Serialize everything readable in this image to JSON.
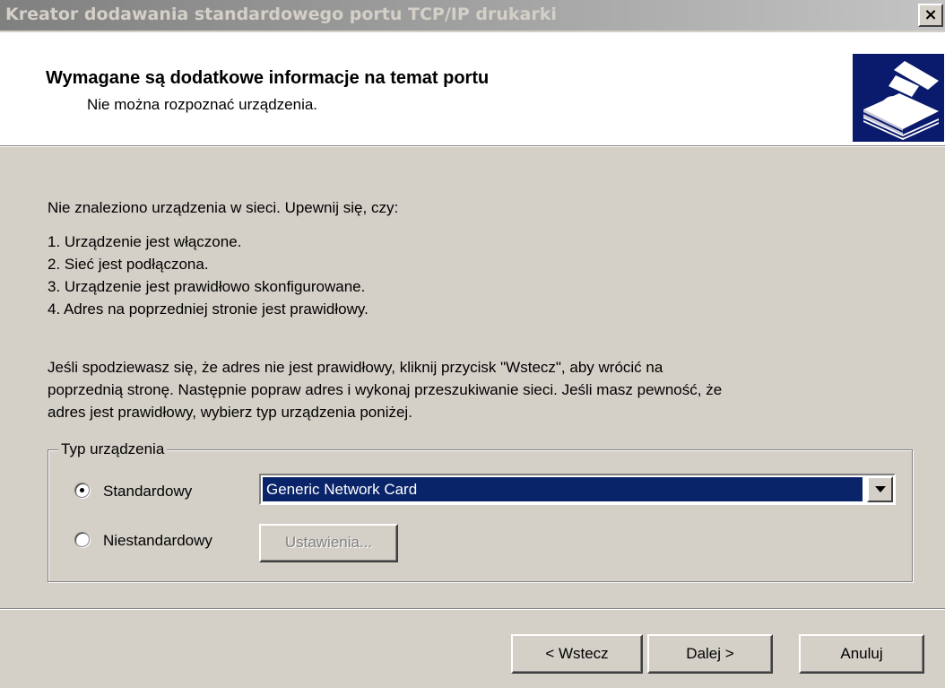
{
  "window": {
    "title": "Kreator dodawania standardowego portu TCP/IP drukarki",
    "close_label": "×"
  },
  "header": {
    "title": "Wymagane są dodatkowe informacje na temat portu",
    "subtitle": "Nie można rozpoznać urządzenia.",
    "icon": "printer-wizard-icon"
  },
  "body": {
    "intro": "Nie znaleziono urządzenia w sieci. Upewnij się, czy:",
    "checklist": [
      "1. Urządzenie jest włączone.",
      "2. Sieć jest podłączona.",
      "3. Urządzenie jest prawidłowo skonfigurowane.",
      "4. Adres na poprzedniej stronie jest prawidłowy."
    ],
    "instructions": [
      "Jeśli spodziewasz się, że adres nie jest prawidłowy, kliknij przycisk \"Wstecz\", aby wrócić na",
      "poprzednią stronę. Następnie popraw adres i wykonaj przeszukiwanie sieci. Jeśli masz pewność, że",
      "adres jest prawidłowy, wybierz typ urządzenia poniżej."
    ]
  },
  "device_type": {
    "legend": "Typ urządzenia",
    "standard_label": "Standardowy",
    "custom_label": "Niestandardowy",
    "selected": "standard",
    "dropdown_value": "Generic Network Card",
    "settings_button": "Ustawienia..."
  },
  "footer": {
    "back_button": "< Wstecz",
    "next_button": "Dalej >",
    "cancel_button": "Anuluj"
  },
  "colors": {
    "title_text": "#d4d0c8",
    "selection": "#0a246a",
    "icon_background": "#0a1a6c",
    "face": "#d4d0c8"
  }
}
